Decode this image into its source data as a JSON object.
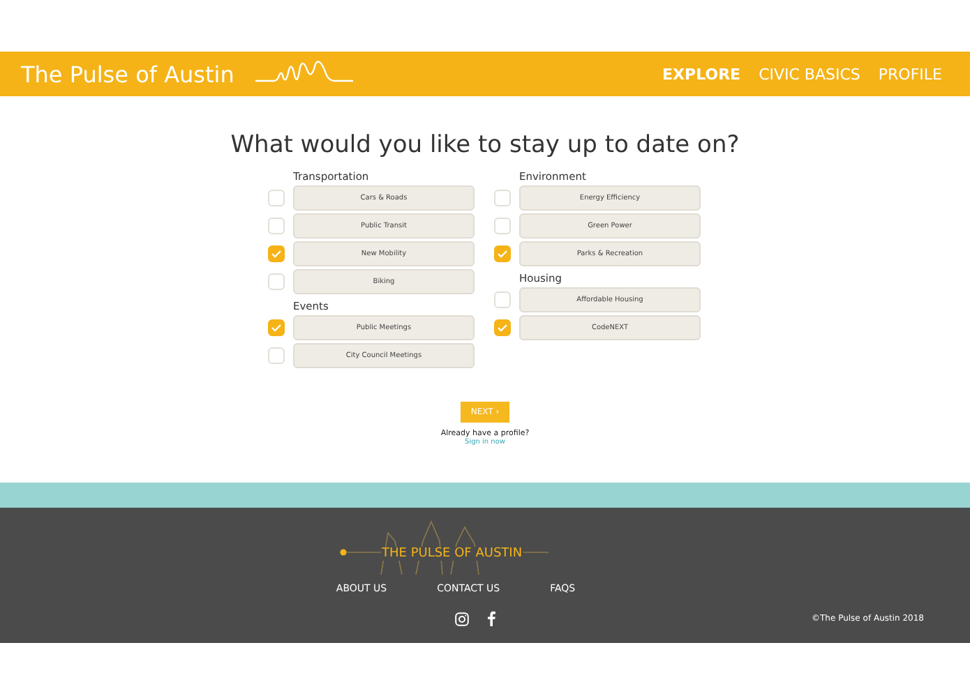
{
  "header": {
    "title": "The Pulse of Austin",
    "nav": [
      {
        "label": "EXPLORE",
        "selected": true
      },
      {
        "label": "CIVIC BASICS",
        "selected": false
      },
      {
        "label": "PROFILE",
        "selected": false
      }
    ]
  },
  "heading": "What would you like to stay up to date on?",
  "columns": [
    [
      {
        "title": "Transportation",
        "options": [
          {
            "label": "Cars & Roads",
            "checked": false
          },
          {
            "label": "Public Transit",
            "checked": false
          },
          {
            "label": "New Mobility",
            "checked": true
          },
          {
            "label": "Biking",
            "checked": false
          }
        ]
      },
      {
        "title": "Events",
        "options": [
          {
            "label": "Public Meetings",
            "checked": true
          },
          {
            "label": "City Council Meetings",
            "checked": false
          }
        ]
      }
    ],
    [
      {
        "title": "Environment",
        "options": [
          {
            "label": "Energy Efficiency",
            "checked": false
          },
          {
            "label": "Green Power",
            "checked": false
          },
          {
            "label": "Parks & Recreation",
            "checked": true
          }
        ]
      },
      {
        "title": "Housing",
        "options": [
          {
            "label": "Affordable Housing",
            "checked": false
          },
          {
            "label": "CodeNEXT",
            "checked": true
          }
        ]
      }
    ]
  ],
  "next_button": "NEXT ›",
  "profile_prompt": "Already have a profile?",
  "sign_in_link": "Sign in now",
  "footer": {
    "logo_text": "THE PULSE OF AUSTIN",
    "links": [
      "ABOUT US",
      "CONTACT US",
      "FAQS"
    ],
    "copyright": "©The Pulse of Austin 2018"
  }
}
